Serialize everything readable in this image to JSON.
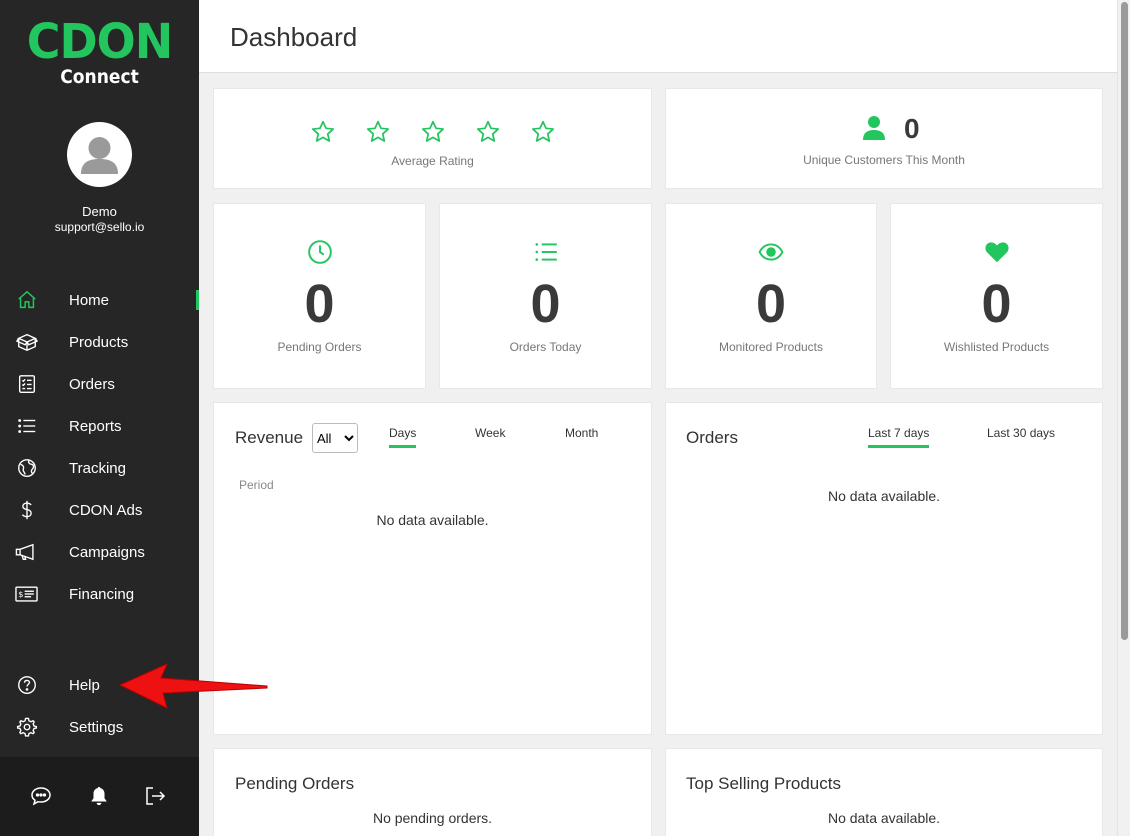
{
  "brand": {
    "name": "CDON",
    "sub": "Connect",
    "accent": "#22c55e"
  },
  "user": {
    "name": "Demo",
    "email": "support@sello.io"
  },
  "nav": [
    {
      "label": "Home",
      "icon": "home-icon",
      "active": true
    },
    {
      "label": "Products",
      "icon": "box-icon"
    },
    {
      "label": "Orders",
      "icon": "orders-list-icon"
    },
    {
      "label": "Reports",
      "icon": "list-icon"
    },
    {
      "label": "Tracking",
      "icon": "globe-icon"
    },
    {
      "label": "CDON Ads",
      "icon": "dollar-icon"
    },
    {
      "label": "Campaigns",
      "icon": "megaphone-icon"
    },
    {
      "label": "Financing",
      "icon": "bill-icon"
    },
    {
      "label": "Help",
      "icon": "help-circle-icon"
    },
    {
      "label": "Settings",
      "icon": "gear-icon"
    }
  ],
  "footer_icons": [
    "chat-icon",
    "bell-icon",
    "logout-icon"
  ],
  "header": {
    "title": "Dashboard"
  },
  "rating": {
    "label": "Average Rating",
    "stars": 5,
    "value": 0
  },
  "customers": {
    "value": "0",
    "label": "Unique Customers This Month"
  },
  "stats": [
    {
      "value": "0",
      "label": "Pending Orders",
      "icon": "clock-icon"
    },
    {
      "value": "0",
      "label": "Orders Today",
      "icon": "list-icon"
    },
    {
      "value": "0",
      "label": "Monitored Products",
      "icon": "eye-icon"
    },
    {
      "value": "0",
      "label": "Wishlisted Products",
      "icon": "heart-icon"
    }
  ],
  "revenue": {
    "title": "Revenue",
    "select_value": "All",
    "tabs": [
      "Days",
      "Week",
      "Month"
    ],
    "active_tab": "Days",
    "period_label": "Period",
    "empty": "No data available."
  },
  "orders_chart": {
    "title": "Orders",
    "tabs": [
      "Last 7 days",
      "Last 30 days"
    ],
    "active_tab": "Last 7 days",
    "empty": "No data available."
  },
  "pending_orders": {
    "title": "Pending Orders",
    "empty": "No pending orders."
  },
  "top_selling": {
    "title": "Top Selling Products",
    "empty": "No data available."
  }
}
